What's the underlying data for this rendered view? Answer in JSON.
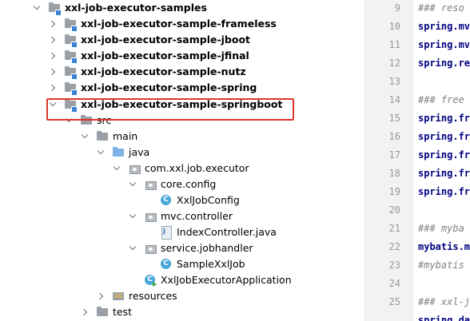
{
  "colors": {
    "highlight_border": "#e0342e",
    "class_icon": "#4aa8d8",
    "module_dot": "#3b82d6",
    "source_folder": "#7fb2e5",
    "code_key": "#000080",
    "code_comment": "#808080"
  },
  "tree": {
    "nodes": [
      {
        "label": "xxl-job-executor-samples",
        "arrow": "down",
        "icon": "module-folder-icon",
        "bold": true
      },
      {
        "label": "xxl-job-executor-sample-frameless",
        "arrow": "right",
        "icon": "module-folder-icon",
        "bold": true
      },
      {
        "label": "xxl-job-executor-sample-jboot",
        "arrow": "right",
        "icon": "module-folder-icon",
        "bold": true
      },
      {
        "label": "xxl-job-executor-sample-jfinal",
        "arrow": "right",
        "icon": "module-folder-icon",
        "bold": true
      },
      {
        "label": "xxl-job-executor-sample-nutz",
        "arrow": "right",
        "icon": "module-folder-icon",
        "bold": true
      },
      {
        "label": "xxl-job-executor-sample-spring",
        "arrow": "right",
        "icon": "module-folder-icon",
        "bold": true
      },
      {
        "label": "xxl-job-executor-sample-springboot",
        "arrow": "down",
        "icon": "module-folder-icon",
        "bold": true
      },
      {
        "label": "src",
        "arrow": "down",
        "icon": "folder-icon",
        "bold": false
      },
      {
        "label": "main",
        "arrow": "down",
        "icon": "folder-icon",
        "bold": false
      },
      {
        "label": "java",
        "arrow": "down",
        "icon": "source-folder-icon",
        "bold": false
      },
      {
        "label": "com.xxl.job.executor",
        "arrow": "down",
        "icon": "package-icon",
        "bold": false
      },
      {
        "label": "core.config",
        "arrow": "down",
        "icon": "package-icon",
        "bold": false
      },
      {
        "label": "XxlJobConfig",
        "arrow": "none",
        "icon": "class-icon",
        "bold": false
      },
      {
        "label": "mvc.controller",
        "arrow": "down",
        "icon": "package-icon",
        "bold": false
      },
      {
        "label": "IndexController.java",
        "arrow": "none",
        "icon": "java-file-icon",
        "bold": false
      },
      {
        "label": "service.jobhandler",
        "arrow": "down",
        "icon": "package-icon",
        "bold": false
      },
      {
        "label": "SampleXxlJob",
        "arrow": "none",
        "icon": "class-icon",
        "bold": false
      },
      {
        "label": "XxlJobExecutorApplication",
        "arrow": "none",
        "icon": "application-class-icon",
        "bold": false
      },
      {
        "label": "resources",
        "arrow": "right",
        "icon": "resources-folder-icon",
        "bold": false
      },
      {
        "label": "test",
        "arrow": "right",
        "icon": "folder-icon",
        "bold": false
      }
    ]
  },
  "gutter": {
    "lines": [
      "9",
      "10",
      "11",
      "12",
      "13",
      "14",
      "15",
      "16",
      "17",
      "18",
      "19",
      "20",
      "21",
      "22",
      "23",
      "24",
      "25"
    ]
  },
  "editor": {
    "lines": [
      {
        "text": "### reso",
        "kind": "comment"
      },
      {
        "text": "spring.mv",
        "kind": "key"
      },
      {
        "text": "spring.mv",
        "kind": "key"
      },
      {
        "text": "spring.re",
        "kind": "key"
      },
      {
        "text": "",
        "kind": "blank"
      },
      {
        "text": "### free",
        "kind": "comment"
      },
      {
        "text": "spring.fr",
        "kind": "key"
      },
      {
        "text": "spring.fr",
        "kind": "key"
      },
      {
        "text": "spring.fr",
        "kind": "key"
      },
      {
        "text": "spring.fr",
        "kind": "key"
      },
      {
        "text": "spring.fr",
        "kind": "key"
      },
      {
        "text": "",
        "kind": "blank"
      },
      {
        "text": "### myba",
        "kind": "comment"
      },
      {
        "text": "mybatis.m",
        "kind": "key"
      },
      {
        "text": "#mybatis",
        "kind": "comment"
      },
      {
        "text": "",
        "kind": "blank"
      },
      {
        "text": "### xxl-j",
        "kind": "comment"
      },
      {
        "text": "spring.da",
        "kind": "key"
      }
    ]
  }
}
